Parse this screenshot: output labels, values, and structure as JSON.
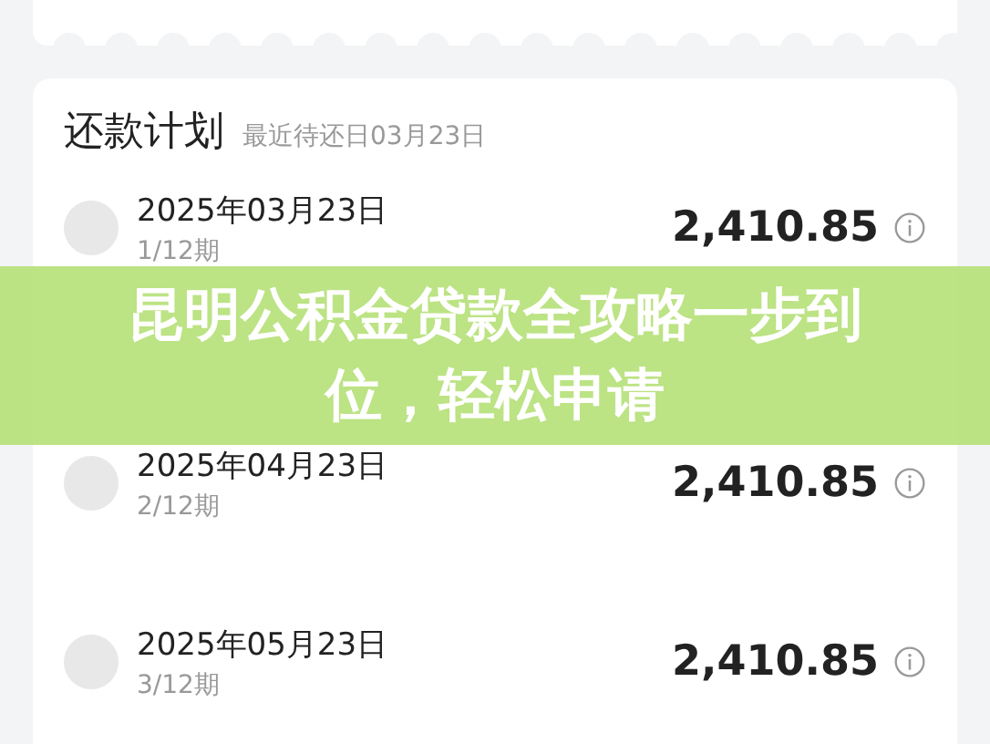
{
  "plan": {
    "title": "还款计划",
    "subtitle": "最近待还日03月23日",
    "rows": [
      {
        "date": "2025年03月23日",
        "period": "1/12期",
        "amount": "2,410.85"
      },
      {
        "date": "2025年04月23日",
        "period": "2/12期",
        "amount": "2,410.85"
      },
      {
        "date": "2025年05月23日",
        "period": "3/12期",
        "amount": "2,410.85"
      }
    ]
  },
  "banner": {
    "text": "昆明公积金贷款全攻略一步到位，轻松申请"
  }
}
